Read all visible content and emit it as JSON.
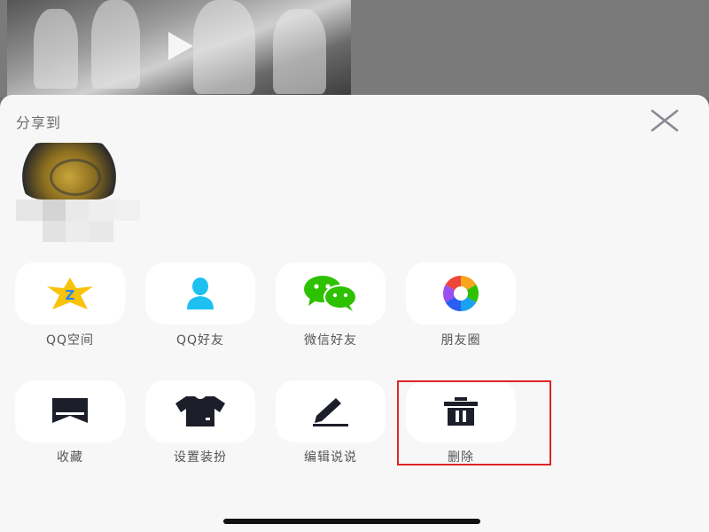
{
  "sheet": {
    "title": "分享到"
  },
  "share_targets": [
    {
      "label": "QQ空间",
      "icon": "qzone-star-icon"
    },
    {
      "label": "QQ好友",
      "icon": "qq-person-icon"
    },
    {
      "label": "微信好友",
      "icon": "wechat-icon"
    },
    {
      "label": "朋友圈",
      "icon": "moments-aperture-icon"
    }
  ],
  "actions": [
    {
      "label": "收藏",
      "icon": "bookmark-icon"
    },
    {
      "label": "设置装扮",
      "icon": "tshirt-icon"
    },
    {
      "label": "编辑说说",
      "icon": "pencil-icon"
    },
    {
      "label": "删除",
      "icon": "trash-icon"
    }
  ],
  "colors": {
    "sheet_bg": "#f7f7f7",
    "tile_bg": "#ffffff",
    "label": "#555555",
    "highlight": "#e02525",
    "qzone_yellow": "#f9c20b",
    "qq_blue": "#1ec0f2",
    "wechat_green": "#2dc100",
    "icon_dark": "#1c1f2a"
  }
}
